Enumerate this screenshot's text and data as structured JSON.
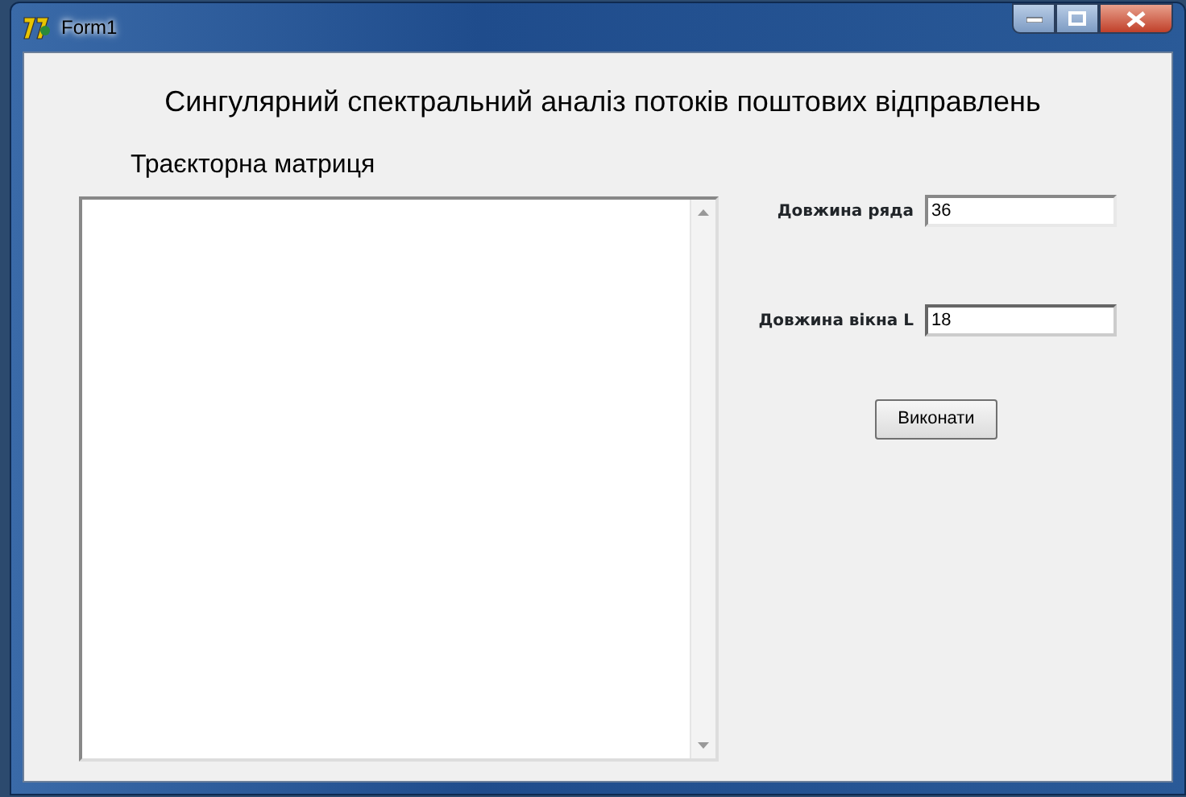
{
  "window": {
    "title": "Form1"
  },
  "heading": "Сингулярний спектральний аналіз потоків поштових відправлень",
  "matrix_label": "Траєкторна матриця",
  "fields": [
    {
      "label": "Довжина ряда",
      "value": "36",
      "focused": false
    },
    {
      "label": "Довжина вікна L",
      "value": "18",
      "focused": true
    }
  ],
  "button": "Виконати"
}
